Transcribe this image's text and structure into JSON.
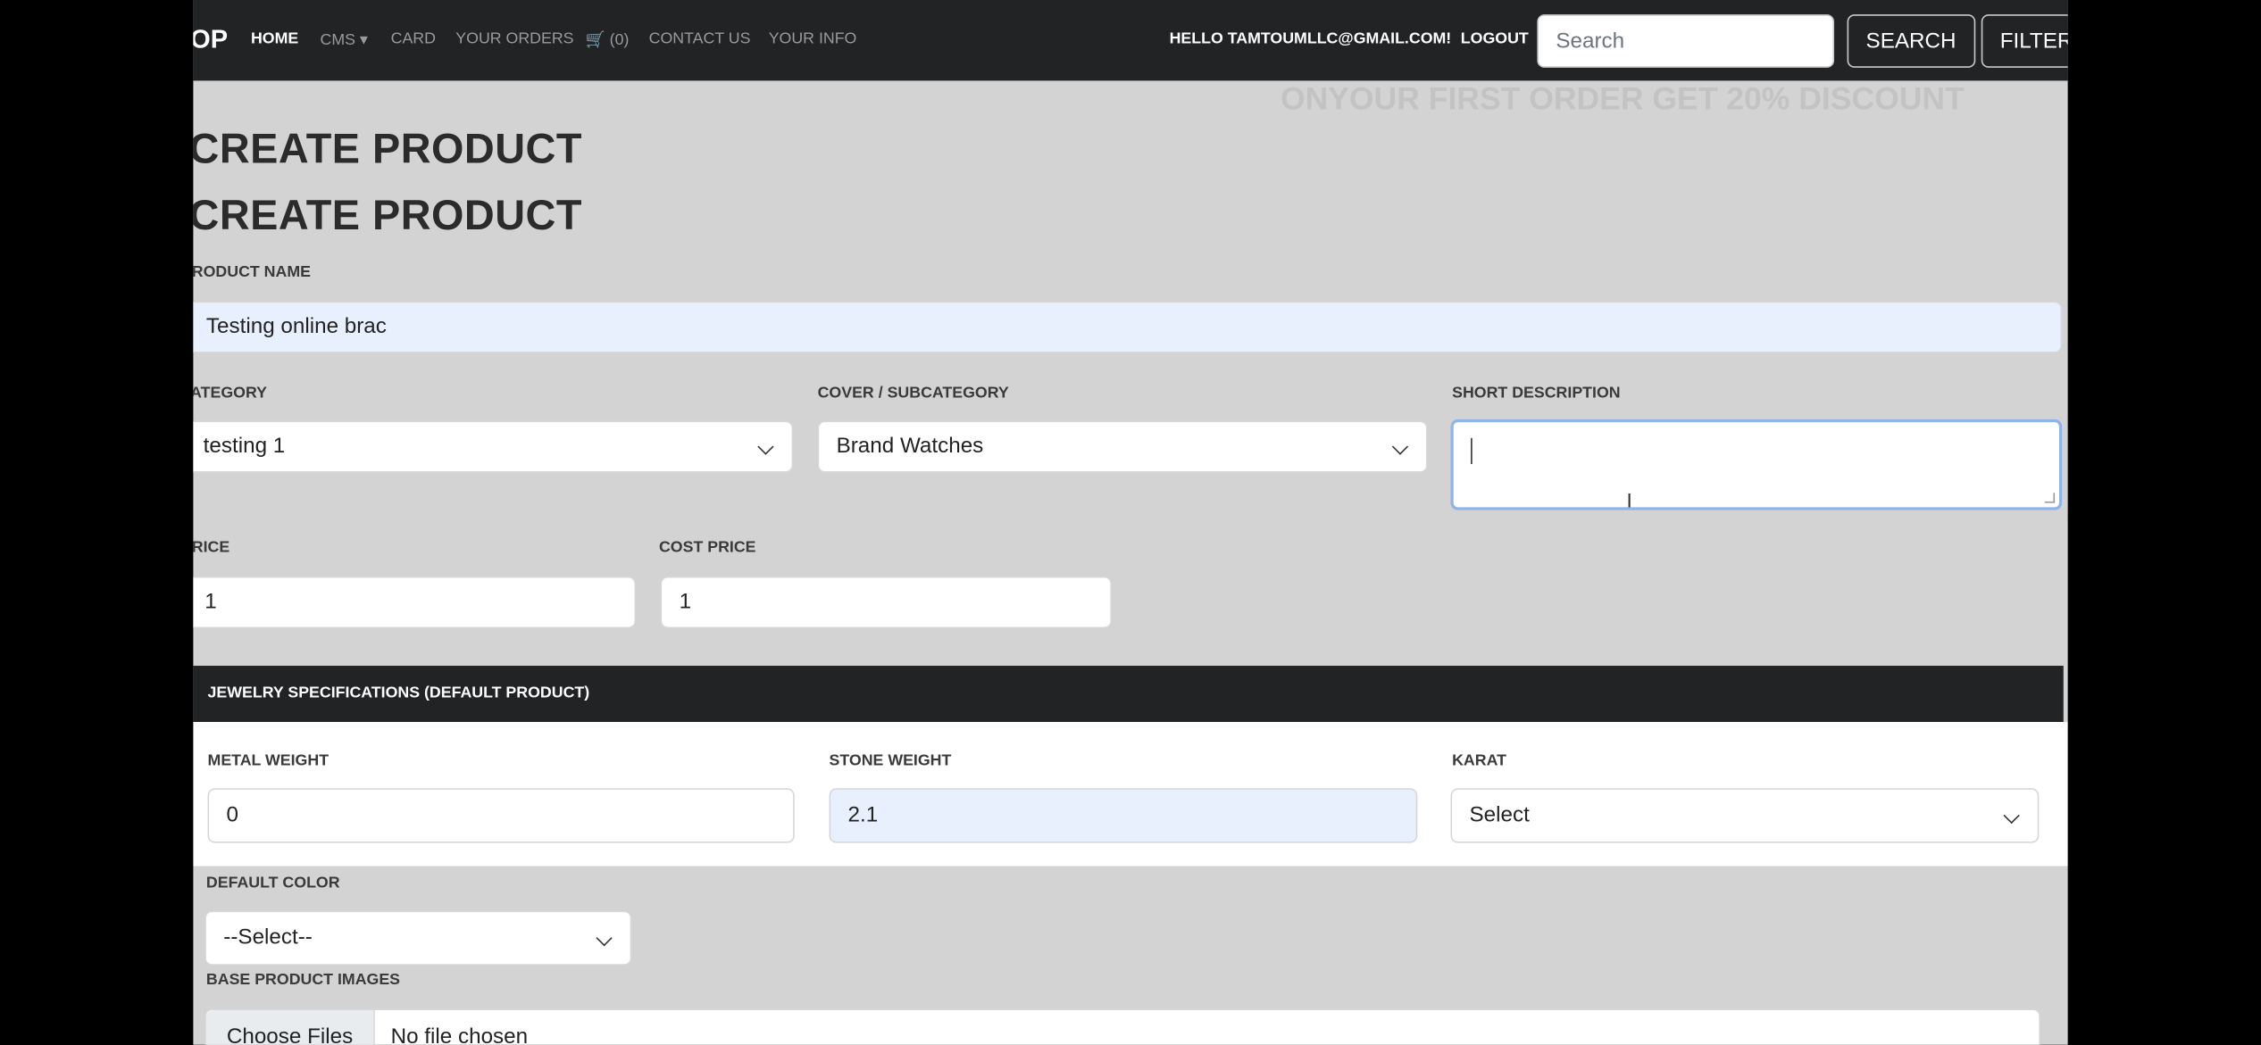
{
  "nav": {
    "brand": "OP",
    "links": [
      "HOME",
      "CMS ▾",
      "CARD",
      "YOUR ORDERS",
      "🛒 (0)",
      "CONTACT US",
      "YOUR INFO"
    ],
    "greeting": "HELLO TAMTOUMLLC@GMAIL.COM!",
    "logout": "LOGOUT",
    "search_placeholder": "Search",
    "search_button": "SEARCH",
    "filter_button": "FILTER"
  },
  "promo": "ONYOUR FIRST ORDER GET 20% DISCOUNT",
  "headings": [
    "CREATE PRODUCT",
    "CREATE PRODUCT"
  ],
  "form": {
    "product_name_label": "RODUCT NAME",
    "product_name_value": "Testing online brac",
    "category_label": "ATEGORY",
    "category_value": "testing 1",
    "subcategory_label": "COVER / SUBCATEGORY",
    "subcategory_value": "Brand Watches",
    "short_description_label": "SHORT DESCRIPTION",
    "short_description_value": "",
    "price_label": "RICE",
    "price_value": "1",
    "cost_price_label": "COST PRICE",
    "cost_price_value": "1"
  },
  "specs": {
    "header": "JEWELRY SPECIFICATIONS (DEFAULT PRODUCT)",
    "metal_weight_label": "METAL WEIGHT",
    "metal_weight_value": "0",
    "stone_weight_label": "STONE WEIGHT",
    "stone_weight_value": "2.1",
    "karat_label": "KARAT",
    "karat_value": "Select"
  },
  "default_color_label": "DEFAULT COLOR",
  "default_color_value": "--Select--",
  "images_label": "BASE PRODUCT IMAGES",
  "choose_files": "Choose Files",
  "no_file": "No file chosen"
}
